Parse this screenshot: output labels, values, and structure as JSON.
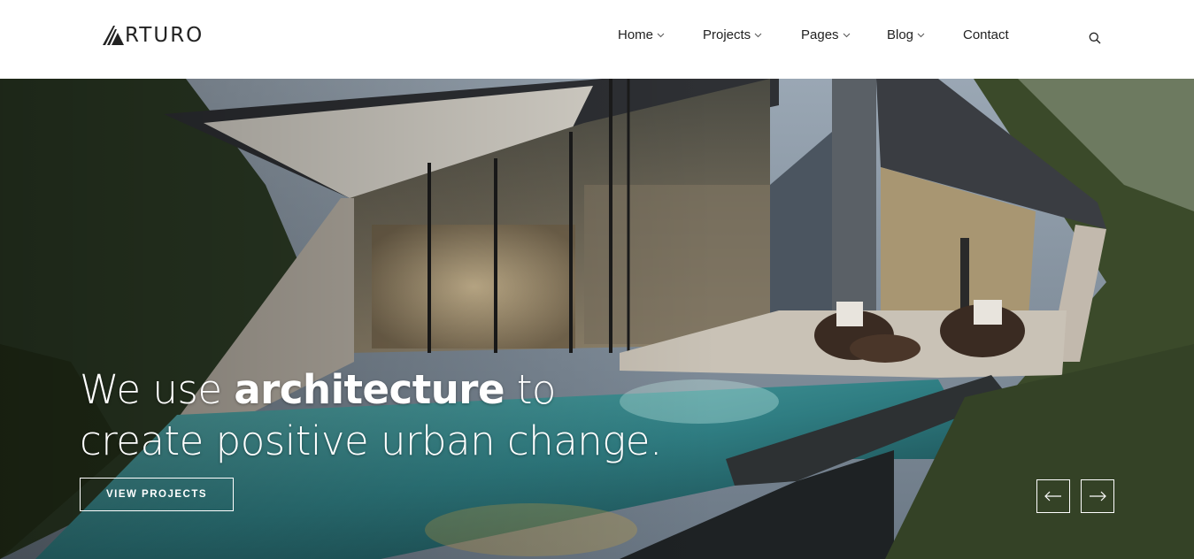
{
  "brand": {
    "logo_text": "RTURO"
  },
  "nav": {
    "items": [
      {
        "label": "Home",
        "has_dropdown": true
      },
      {
        "label": "Projects",
        "has_dropdown": true
      },
      {
        "label": "Pages",
        "has_dropdown": true
      },
      {
        "label": "Blog",
        "has_dropdown": true
      },
      {
        "label": "Contact",
        "has_dropdown": false
      }
    ],
    "search_icon": "search-icon"
  },
  "hero": {
    "headline_pre": "We use ",
    "headline_bold": "architecture",
    "headline_post": " to",
    "headline_line2": "create positive urban change.",
    "cta_label": "VIEW PROJECTS",
    "prev_icon": "arrow-left-icon",
    "next_icon": "arrow-right-icon"
  },
  "colors": {
    "text_dark": "#222222",
    "hero_text": "#ffffff"
  }
}
